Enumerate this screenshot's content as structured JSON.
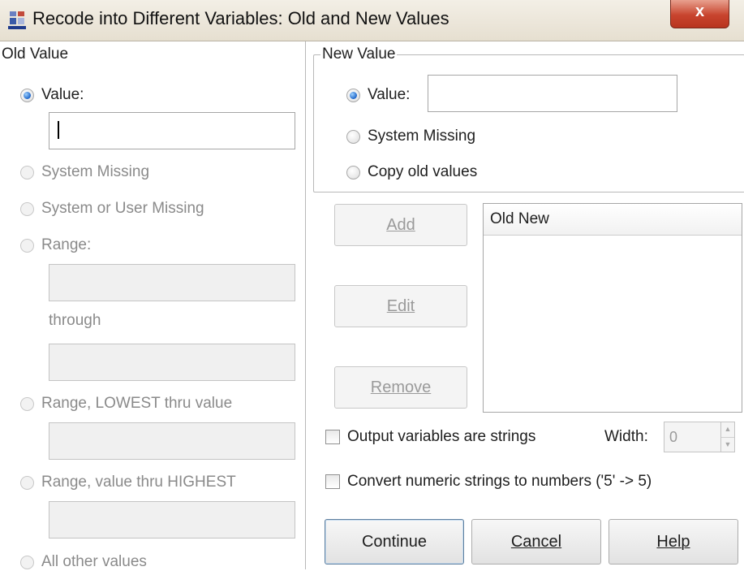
{
  "window": {
    "title": "Recode into Different Variables: Old and New Values",
    "close_label": "x"
  },
  "old_value": {
    "group_label": "Old Value",
    "options": {
      "value": "Value:",
      "system_missing": "System Missing",
      "system_or_user_missing": "System or User Missing",
      "range": "Range:",
      "through": "through",
      "range_lowest": "Range, LOWEST thru value",
      "range_highest": "Range, value thru HIGHEST",
      "all_other": "All other values"
    },
    "selected": "value",
    "value_input": ""
  },
  "new_value": {
    "group_label": "New Value",
    "options": {
      "value": "Value:",
      "system_missing": "System Missing",
      "copy_old": "Copy old values"
    },
    "selected": "value",
    "value_input": ""
  },
  "mapping": {
    "header": "Old New",
    "rows": []
  },
  "buttons": {
    "add": "Add",
    "edit": "Edit",
    "remove": "Remove",
    "continue": "Continue",
    "cancel": "Cancel",
    "help": "Help"
  },
  "options": {
    "output_strings": "Output variables are strings",
    "width_label": "Width:",
    "width_value": "0",
    "convert_numeric": "Convert numeric strings to numbers ('5' -> 5)"
  },
  "colors": {
    "radio_selected": "#1f66c9",
    "close_button": "#c8442e"
  }
}
